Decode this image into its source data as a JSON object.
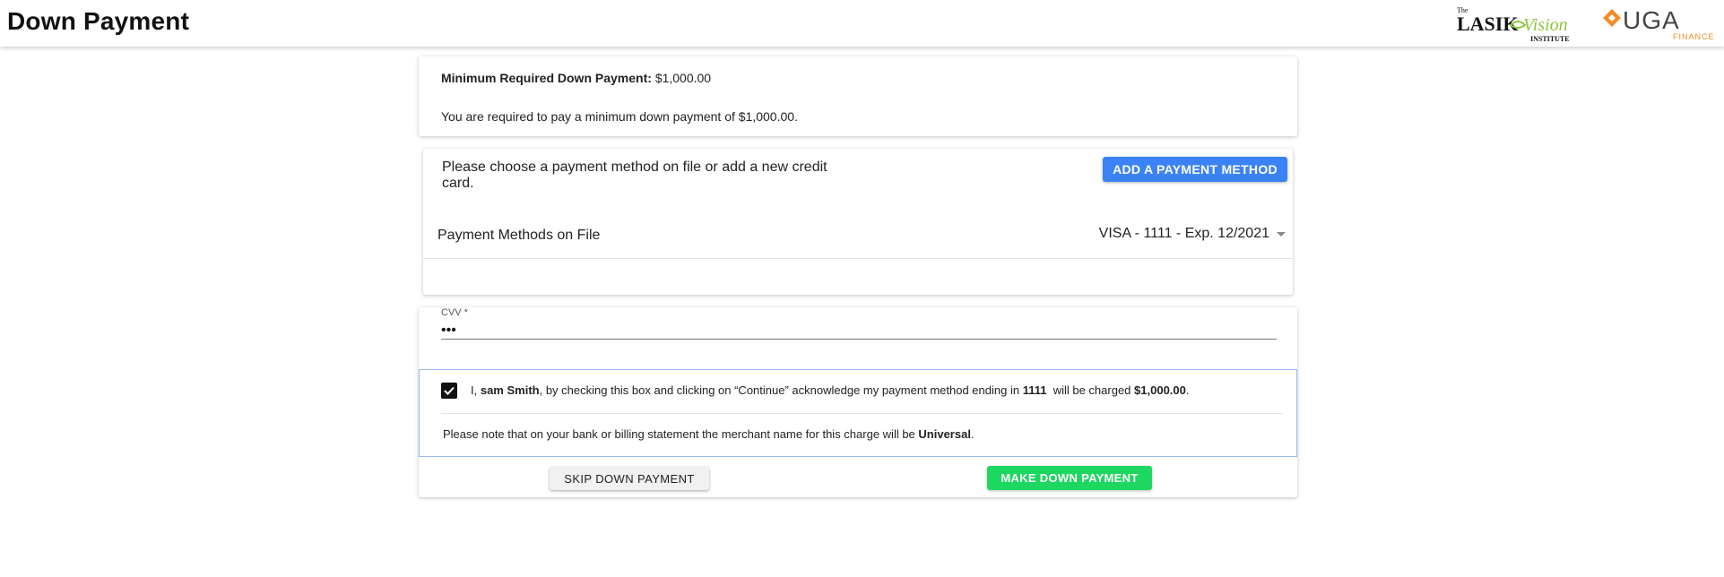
{
  "header": {
    "title": "Down Payment",
    "logo_lasik": {
      "the": "The",
      "lasik": "LASIK",
      "vision": "Vision",
      "institute": "INSTITUTE"
    },
    "logo_uga": {
      "name": "UGA",
      "sub": "FINANCE"
    }
  },
  "summary": {
    "min_label": "Minimum Required Down Payment:",
    "min_value": "$1,000.00",
    "required_text": "You are required to pay a minimum down payment of $1,000.00."
  },
  "payment": {
    "instruction": "Please choose a payment method on file or add a new credit card.",
    "add_button": "ADD A PAYMENT METHOD",
    "methods_label": "Payment Methods on File",
    "selected_method": "VISA - 1111 - Exp. 12/2021"
  },
  "cvv": {
    "label": "CVV *",
    "value": "•••"
  },
  "consent": {
    "checked": true,
    "prefix": "I, ",
    "name": "sam Smith",
    "middle": ", by checking this box and clicking on “Continue” acknowledge my payment method ending in ",
    "last4": "1111",
    "charged_text": "  will be charged ",
    "amount": "$1,000.00",
    "period": ".",
    "merchant_prefix": "Please note that on your bank or billing statement the merchant name for this charge will be ",
    "merchant_name": "Universal",
    "merchant_suffix": "."
  },
  "actions": {
    "skip": "SKIP DOWN PAYMENT",
    "make": "MAKE DOWN PAYMENT"
  },
  "colors": {
    "primary_blue": "#3b82f6",
    "success_green": "#1ed760",
    "uga_orange": "#f28c28",
    "lasik_green": "#8cc63f"
  }
}
